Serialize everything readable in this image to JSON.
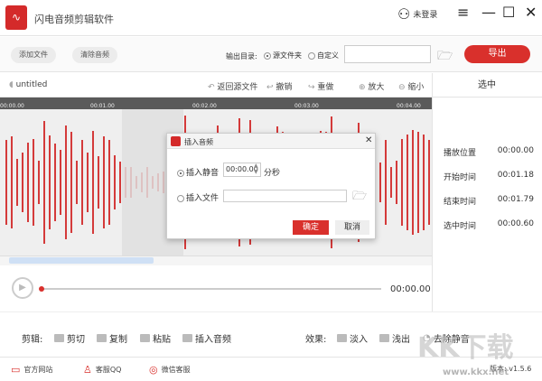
{
  "app": {
    "title": "闪电音频剪辑软件",
    "user": "未登录"
  },
  "toolbar": {
    "add_file": "添加文件",
    "clear_audio": "清除音频",
    "output_dir_label": "输出目录:",
    "opt_source": "源文件夹",
    "opt_custom": "自定义",
    "path_value": "",
    "export": "导出"
  },
  "editor": {
    "filename": "untitled",
    "revert": "返回源文件",
    "undo": "撤销",
    "redo": "重做",
    "zoom_in": "放大",
    "zoom_out": "缩小",
    "ticks": [
      "00:00.00",
      "00:01.00",
      "00:02.00",
      "00:03.00",
      "00:04.00"
    ],
    "current_time": "00:00.00"
  },
  "panel": {
    "title": "选中",
    "rows": [
      {
        "label": "播放位置",
        "value": "00:00.00"
      },
      {
        "label": "开始时间",
        "value": "00:01.18"
      },
      {
        "label": "结束时间",
        "value": "00:01.79"
      },
      {
        "label": "选中时间",
        "value": "00:00.60"
      }
    ]
  },
  "edit": {
    "label": "剪辑:",
    "cut": "剪切",
    "copy": "复制",
    "paste": "粘贴",
    "insert": "插入音频",
    "effects_label": "效果:",
    "fade_in": "淡入",
    "fade_out": "浅出",
    "remove_silence": "去除静音"
  },
  "footer": {
    "website": "官方网站",
    "qq": "客服QQ",
    "wechat": "微信客服",
    "version": "版本: v1.5.6"
  },
  "dialog": {
    "title": "插入音频",
    "opt_silence": "插入静音",
    "silence_value": "00:00.00",
    "unit": "分秒",
    "opt_file": "插入文件",
    "file_value": "",
    "ok": "确定",
    "cancel": "取消"
  },
  "watermark": {
    "text": "KK下载",
    "url": "www.kkx.net"
  },
  "colors": {
    "accent": "#d9302c"
  }
}
